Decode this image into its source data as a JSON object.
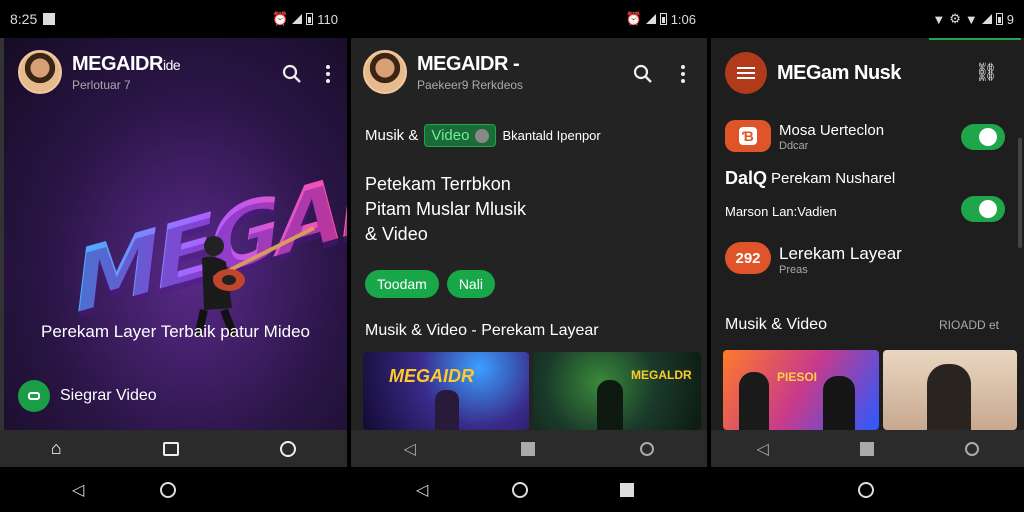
{
  "status": {
    "left_time": "8:25",
    "mid_time": "110",
    "right_time": "1:06",
    "far_right": "9"
  },
  "screen1": {
    "title": "MEGAIDR",
    "title_suffix": "ide",
    "subtitle": "Perlotuar 7",
    "logo_text": "MEGADR",
    "tagline": "Perekam Layer Terbaik patur Mideo",
    "action_label": "Siegrar Video",
    "accent": "#1a9e45"
  },
  "screen2": {
    "title": "MEGAIDR -",
    "subtitle": "Paekeer9 Rerkdeos",
    "filter_prefix": "Musik &",
    "filter_video": "Video",
    "filter_suffix": "Bkantald Ipenpor",
    "heading_lines": [
      "Petekam Terrbkon",
      "Pitam Muslar Mlusik",
      "& Video"
    ],
    "pill1": "Toodam",
    "pill2": "Nali",
    "section_title": "Musik & Video - Perekam Layear",
    "thumb1_text": "MEGAIDR",
    "thumb2_text": "MEGALDR"
  },
  "screen3": {
    "title": "MEGam Nusk",
    "row1_title": "Mosa Uerteclon",
    "row1_sub": "Ddcar",
    "row2_title_a": "DalQ",
    "row2_title_b": "Perekam Nusharel",
    "row2_label": "Marson Lan:Vadien",
    "row3_badge": "292",
    "row3_title": "Lerekam Layear",
    "row3_sub": "Preas",
    "section_title": "Musik & Video",
    "section_meta": "RIOADD et",
    "thumb1_text": "PIESOI"
  },
  "colors": {
    "green": "#1fa64a",
    "orange": "#e0542a",
    "purple_bg": "#2a1546"
  }
}
